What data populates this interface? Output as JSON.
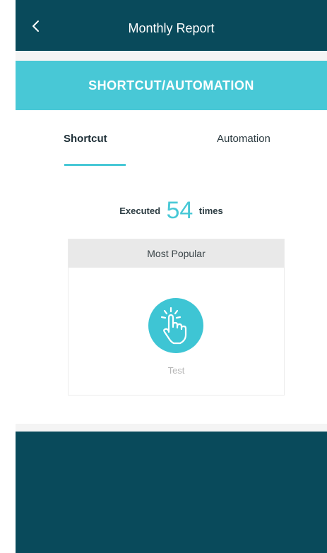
{
  "header": {
    "title": "Monthly Report",
    "back_icon": "chevron-left-icon"
  },
  "banner": {
    "title": "SHORTCUT/AUTOMATION"
  },
  "tabs": [
    {
      "label": "Shortcut",
      "active": true
    },
    {
      "label": "Automation",
      "active": false
    }
  ],
  "summary": {
    "prefix": "Executed",
    "count": "54",
    "suffix": "times"
  },
  "most_popular": {
    "heading": "Most Popular",
    "item_label": "Test",
    "item_icon": "hand-tap-icon"
  },
  "colors": {
    "header_bg": "#094a5b",
    "accent": "#48c8d6"
  }
}
